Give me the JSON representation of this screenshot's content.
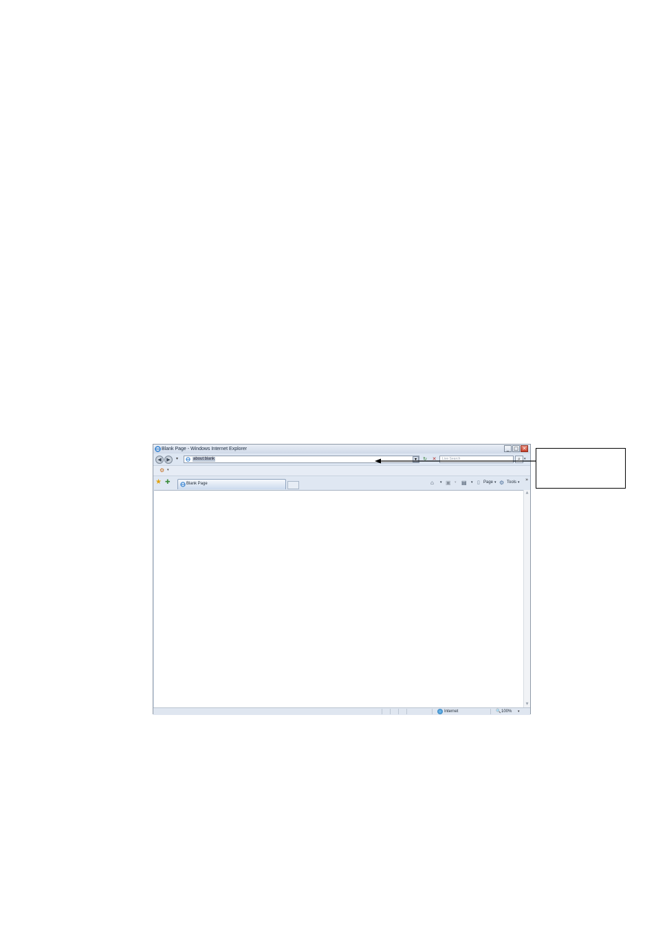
{
  "window": {
    "title": "Blank Page - Windows Internet Explorer",
    "minimize_glyph": "_",
    "maximize_glyph": "□",
    "close_glyph": "✕"
  },
  "navigation": {
    "back_glyph": "◀",
    "forward_glyph": "▶",
    "history_drop": "▾",
    "address_value": "about:blank",
    "address_drop": "▾",
    "refresh_glyph": "↻",
    "stop_glyph": "✕",
    "search_placeholder": "Live Search",
    "search_glyph": "⌕",
    "search_drop": "▾"
  },
  "links_bar": {
    "icon": "⚙",
    "drop": "▾"
  },
  "tabs": {
    "favorites_glyph": "★",
    "add_favorites_glyph": "✚",
    "active_tab_label": "Blank Page"
  },
  "command_bar": {
    "home_glyph": "⌂",
    "feeds_glyph": "▣",
    "print_glyph": "▤",
    "page_icon": "▯",
    "page_label": "Page",
    "tools_icon": "⚙",
    "tools_label": "Tools",
    "drop": "▾",
    "more": "»"
  },
  "scrollbar": {
    "up": "▲",
    "down": "▼"
  },
  "status_bar": {
    "zone_label": "Internet",
    "zoom_icon": "🔍",
    "zoom_level": "100%",
    "zoom_drop": "▾"
  },
  "colors": {
    "chrome": "#dde6f2",
    "close_button": "#c7402c",
    "address_highlight": "#b9c4d3"
  }
}
